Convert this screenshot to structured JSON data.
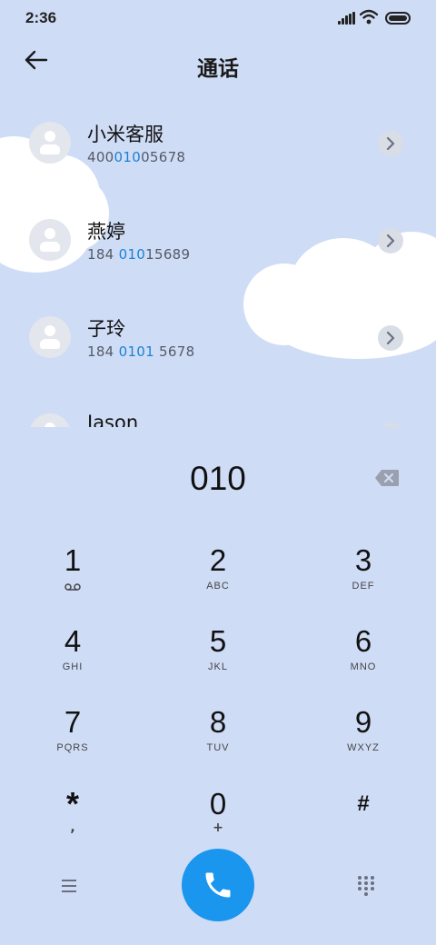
{
  "status_bar": {
    "time": "2:36"
  },
  "header": {
    "title": "通话"
  },
  "contacts": [
    {
      "name": "小米客服",
      "number_pre": "400",
      "number_match": "010",
      "number_post": "05678"
    },
    {
      "name": "燕婷",
      "number_pre": "184 ",
      "number_match": "010",
      "number_post": "15689"
    },
    {
      "name": "子玲",
      "number_pre": "184 ",
      "number_match": "0101",
      "number_post": " 5678"
    },
    {
      "name": "Jason",
      "number_pre": "",
      "number_match": "",
      "number_post": ""
    }
  ],
  "dialpad": {
    "input": "010",
    "keys": [
      {
        "digit": "1",
        "letters": ""
      },
      {
        "digit": "2",
        "letters": "ABC"
      },
      {
        "digit": "3",
        "letters": "DEF"
      },
      {
        "digit": "4",
        "letters": "GHI"
      },
      {
        "digit": "5",
        "letters": "JKL"
      },
      {
        "digit": "6",
        "letters": "MNO"
      },
      {
        "digit": "7",
        "letters": "PQRS"
      },
      {
        "digit": "8",
        "letters": "TUV"
      },
      {
        "digit": "9",
        "letters": "WXYZ"
      },
      {
        "digit": "*",
        "letters": ","
      },
      {
        "digit": "0",
        "letters": "+"
      },
      {
        "digit": "#",
        "letters": ""
      }
    ]
  },
  "colors": {
    "accent": "#1a96ee",
    "match_highlight": "#1a82d6",
    "background": "#cfdcf6"
  },
  "icons": {
    "back": "arrow-left-icon",
    "backspace": "backspace-icon",
    "voicemail": "voicemail-icon",
    "call": "phone-icon",
    "menu": "menu-icon",
    "dialpad_toggle": "dialpad-icon"
  }
}
